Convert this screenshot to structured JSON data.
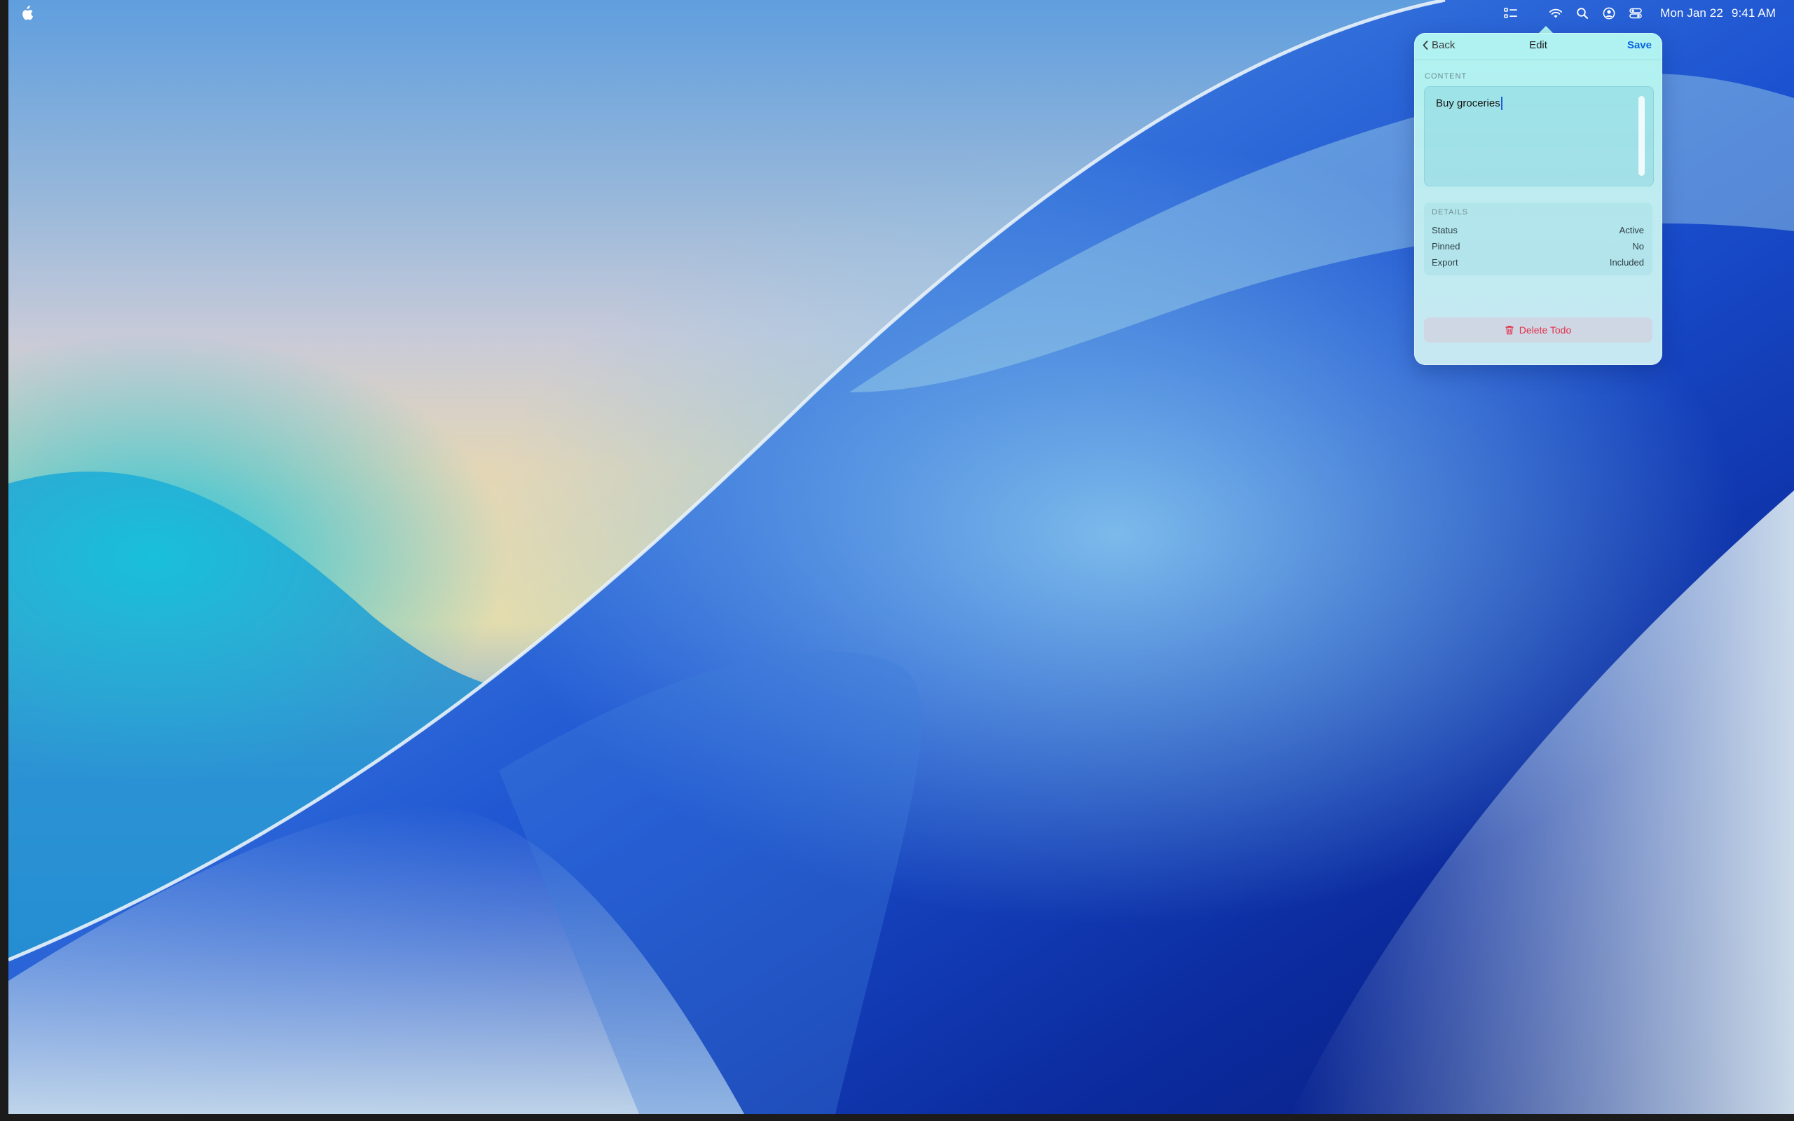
{
  "menubar": {
    "clock_date": "Mon Jan 22",
    "clock_time": "9:41 AM",
    "icons": [
      "apple-logo",
      "todo-list-icon",
      "wifi-icon",
      "search-icon",
      "user-icon",
      "control-center-icon"
    ]
  },
  "popover": {
    "back_label": "Back",
    "title": "Edit",
    "save_label": "Save",
    "content_label": "CONTENT",
    "content_value": "Buy groceries",
    "details_label": "DETAILS",
    "details": [
      {
        "key": "Status",
        "value": "Active"
      },
      {
        "key": "Pinned",
        "value": "No"
      },
      {
        "key": "Export",
        "value": "Included"
      }
    ],
    "delete_label": "Delete Todo"
  },
  "colors": {
    "accent": "#0a66e0",
    "destructive": "#e3304a",
    "popover_bg": "#aef3f1"
  }
}
